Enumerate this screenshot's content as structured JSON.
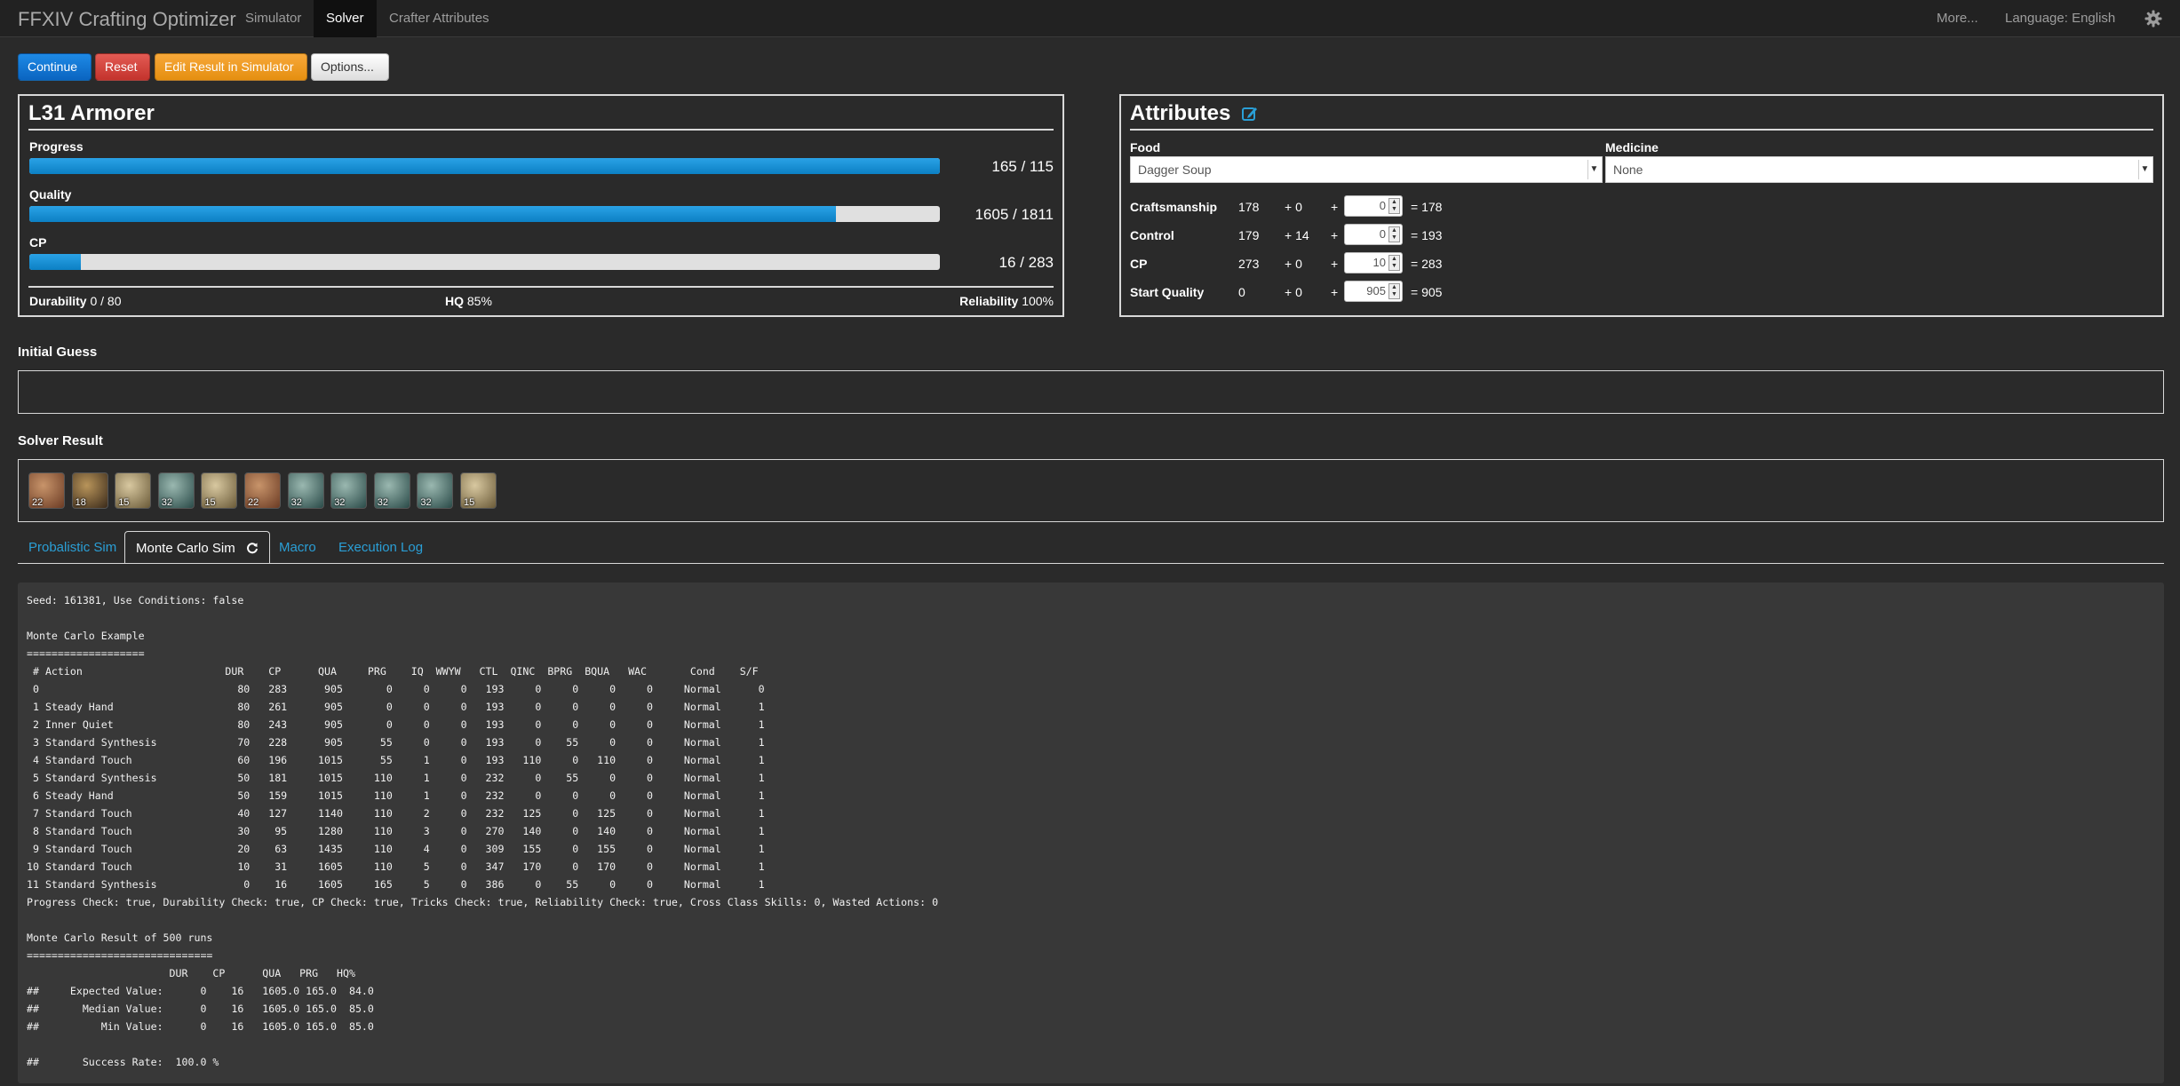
{
  "navbar": {
    "brand": "FFXIV Crafting Optimizer",
    "items": [
      "Simulator",
      "Solver",
      "Crafter Attributes"
    ],
    "active": "Solver",
    "more": "More...",
    "language": "Language: English",
    "settings_icon": "gear-icon"
  },
  "toolbar": {
    "continue": "Continue",
    "reset": "Reset",
    "edit_result": "Edit Result in Simulator",
    "options": "Options..."
  },
  "colors": {
    "primary": "#0a64c0",
    "danger": "#c3332c",
    "warning": "#e58f10",
    "bar": "#0c80c4",
    "link": "#2a9fd6"
  },
  "recipe": {
    "title": "L31 Armorer",
    "progress_label": "Progress",
    "progress_value": "165 / 115",
    "progress_fraction": 1.0,
    "quality_label": "Quality",
    "quality_value": "1605 / 1811",
    "quality_fraction": 0.886,
    "cp_label": "CP",
    "cp_value": "16 / 283",
    "cp_fraction": 0.0565,
    "durability_label": "Durability",
    "durability_value": "0 / 80",
    "hq_label": "HQ",
    "hq_value": "85%",
    "reliability_label": "Reliability",
    "reliability_value": "100%"
  },
  "attributes": {
    "title": "Attributes",
    "food_label": "Food",
    "food_value": "Dagger Soup",
    "medicine_label": "Medicine",
    "medicine_value": "None",
    "rows": [
      {
        "name": "Craftsmanship",
        "base": "178",
        "bonus": "+ 0",
        "plus": "+",
        "input": "0",
        "total": "= 178"
      },
      {
        "name": "Control",
        "base": "179",
        "bonus": "+ 14",
        "plus": "+",
        "input": "0",
        "total": "= 193"
      },
      {
        "name": "CP",
        "base": "273",
        "bonus": "+ 0",
        "plus": "+",
        "input": "10",
        "total": "= 283"
      },
      {
        "name": "Start Quality",
        "base": "0",
        "bonus": "+ 0",
        "plus": "+",
        "input": "905",
        "total": "= 905"
      }
    ]
  },
  "initial_guess": {
    "label": "Initial Guess"
  },
  "solver_result": {
    "label": "Solver Result",
    "skills": [
      {
        "name": "steady-hand-icon",
        "level": "22"
      },
      {
        "name": "inner-quiet-icon",
        "level": "18"
      },
      {
        "name": "standard-synthesis-icon",
        "level": "15"
      },
      {
        "name": "standard-touch-icon",
        "level": "32"
      },
      {
        "name": "standard-synthesis-icon",
        "level": "15"
      },
      {
        "name": "steady-hand-icon",
        "level": "22"
      },
      {
        "name": "standard-touch-icon",
        "level": "32"
      },
      {
        "name": "standard-touch-icon",
        "level": "32"
      },
      {
        "name": "standard-touch-icon",
        "level": "32"
      },
      {
        "name": "standard-touch-icon",
        "level": "32"
      },
      {
        "name": "standard-synthesis-icon",
        "level": "15"
      }
    ]
  },
  "tabs": {
    "probabilistic": "Probalistic Sim",
    "monte_carlo": "Monte Carlo Sim",
    "macro": "Macro",
    "log": "Execution Log"
  },
  "log_lines": [
    "Seed: 161381, Use Conditions: false",
    "",
    "Monte Carlo Example",
    "===================",
    " # Action                       DUR    CP      QUA     PRG    IQ  WWYW   CTL  QINC  BPRG  BQUA   WAC       Cond    S/F",
    " 0                                80   283      905       0     0     0   193     0     0     0     0     Normal      0",
    " 1 Steady Hand                    80   261      905       0     0     0   193     0     0     0     0     Normal      1",
    " 2 Inner Quiet                    80   243      905       0     0     0   193     0     0     0     0     Normal      1",
    " 3 Standard Synthesis             70   228      905      55     0     0   193     0    55     0     0     Normal      1",
    " 4 Standard Touch                 60   196     1015      55     1     0   193   110     0   110     0     Normal      1",
    " 5 Standard Synthesis             50   181     1015     110     1     0   232     0    55     0     0     Normal      1",
    " 6 Steady Hand                    50   159     1015     110     1     0   232     0     0     0     0     Normal      1",
    " 7 Standard Touch                 40   127     1140     110     2     0   232   125     0   125     0     Normal      1",
    " 8 Standard Touch                 30    95     1280     110     3     0   270   140     0   140     0     Normal      1",
    " 9 Standard Touch                 20    63     1435     110     4     0   309   155     0   155     0     Normal      1",
    "10 Standard Touch                 10    31     1605     110     5     0   347   170     0   170     0     Normal      1",
    "11 Standard Synthesis              0    16     1605     165     5     0   386     0    55     0     0     Normal      1",
    "Progress Check: true, Durability Check: true, CP Check: true, Tricks Check: true, Reliability Check: true, Cross Class Skills: 0, Wasted Actions: 0",
    "",
    "Monte Carlo Result of 500 runs",
    "==============================",
    "                       DUR    CP      QUA   PRG   HQ%",
    "##     Expected Value:      0    16   1605.0 165.0  84.0",
    "##       Median Value:      0    16   1605.0 165.0  85.0",
    "##          Min Value:      0    16   1605.0 165.0  85.0",
    "",
    "##       Success Rate:  100.0 %"
  ]
}
